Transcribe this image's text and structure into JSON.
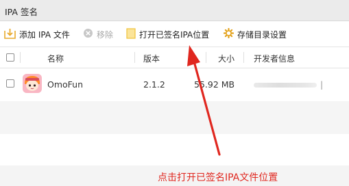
{
  "window": {
    "title": "IPA 签名"
  },
  "toolbar": {
    "add_label": "添加 IPA 文件",
    "remove_label": "移除",
    "open_label": "打开已签名IPA位置",
    "storage_label": "存储目录设置"
  },
  "table": {
    "columns": {
      "name": "名称",
      "version": "版本",
      "size": "大小",
      "publisher": "开发者信息"
    },
    "rows": [
      {
        "name": "OmoFun",
        "version": "2.1.2",
        "size": "55.92 MB",
        "publisher_suffix": "|"
      }
    ]
  },
  "annotation": {
    "text": "点击打开已签名IPA文件位置",
    "color": "#e0271f"
  },
  "colors": {
    "accent_yellow": "#f3c53a",
    "folder_light": "#fbe49a",
    "disabled": "#a9a9a9",
    "annotation_red": "#e0271f"
  },
  "icons": [
    "add-file-icon",
    "remove-icon",
    "folder-icon",
    "gear-icon",
    "app-icon"
  ]
}
